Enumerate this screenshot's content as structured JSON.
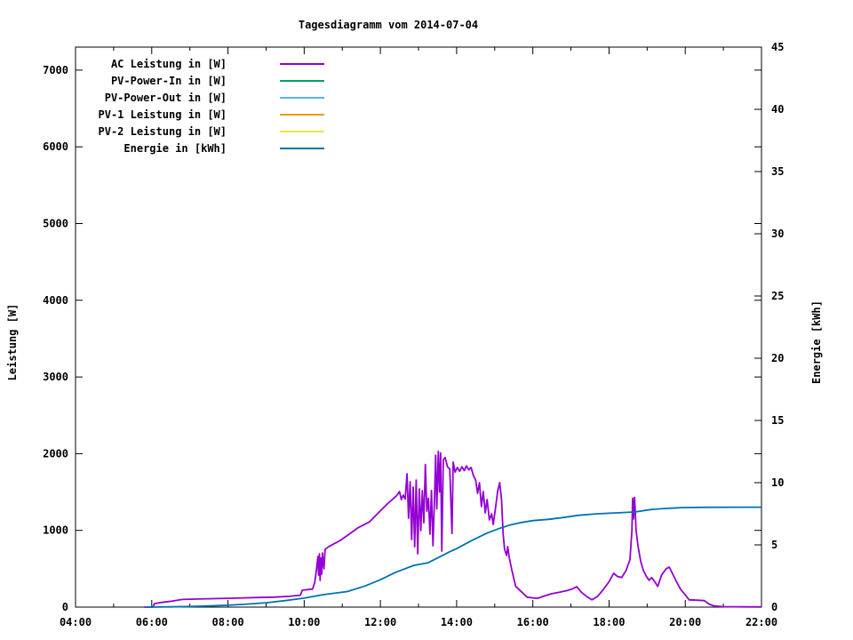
{
  "chart_data": {
    "type": "line",
    "title": "Tagesdiagramm vom 2014-07-04",
    "x_axis": {
      "range_hours": [
        4,
        22
      ],
      "major_tick_hours": [
        4,
        6,
        8,
        10,
        12,
        14,
        16,
        18,
        20,
        22
      ],
      "major_tick_labels": [
        "04:00",
        "06:00",
        "08:00",
        "10:00",
        "12:00",
        "14:00",
        "16:00",
        "18:00",
        "20:00",
        "22:00"
      ],
      "minor_tick_hours": [
        5,
        7,
        9,
        11,
        13,
        15,
        17,
        19,
        21
      ]
    },
    "y_axis_left": {
      "label": "Leistung [W]",
      "tick_values": [
        0,
        1000,
        2000,
        3000,
        4000,
        5000,
        6000,
        7000
      ],
      "range": [
        0,
        7300
      ]
    },
    "y_axis_right": {
      "label": "Energie [kWh]",
      "tick_values": [
        0,
        5,
        10,
        15,
        20,
        25,
        30,
        35,
        40,
        45
      ],
      "range": [
        0,
        45
      ]
    },
    "legend_position": "top-left",
    "grid": false,
    "series": [
      {
        "name": "AC Leistung in [W]",
        "color": "#9400d3",
        "axis": "left",
        "points": [
          [
            5.8,
            0
          ],
          [
            6.03,
            0
          ],
          [
            6.07,
            45
          ],
          [
            6.25,
            60
          ],
          [
            6.55,
            80
          ],
          [
            6.8,
            100
          ],
          [
            7.2,
            105
          ],
          [
            7.6,
            110
          ],
          [
            8.0,
            115
          ],
          [
            8.4,
            120
          ],
          [
            8.8,
            125
          ],
          [
            9.2,
            130
          ],
          [
            9.6,
            140
          ],
          [
            9.9,
            155
          ],
          [
            9.95,
            220
          ],
          [
            10.22,
            235
          ],
          [
            10.28,
            324
          ],
          [
            10.33,
            520
          ],
          [
            10.36,
            660
          ],
          [
            10.38,
            417
          ],
          [
            10.4,
            695
          ],
          [
            10.42,
            348
          ],
          [
            10.44,
            640
          ],
          [
            10.46,
            430
          ],
          [
            10.48,
            707
          ],
          [
            10.52,
            500
          ],
          [
            10.55,
            753
          ],
          [
            10.65,
            790
          ],
          [
            10.8,
            830
          ],
          [
            10.95,
            870
          ],
          [
            11.15,
            940
          ],
          [
            11.4,
            1030
          ],
          [
            11.72,
            1113
          ],
          [
            11.95,
            1230
          ],
          [
            12.18,
            1344
          ],
          [
            12.42,
            1449
          ],
          [
            12.5,
            1506
          ],
          [
            12.55,
            1402
          ],
          [
            12.6,
            1460
          ],
          [
            12.65,
            1410
          ],
          [
            12.7,
            1738
          ],
          [
            12.74,
            1159
          ],
          [
            12.78,
            1634
          ],
          [
            12.82,
            881
          ],
          [
            12.86,
            1564
          ],
          [
            12.9,
            788
          ],
          [
            12.94,
            1657
          ],
          [
            12.98,
            695
          ],
          [
            13.02,
            1541
          ],
          [
            13.06,
            997
          ],
          [
            13.1,
            1518
          ],
          [
            13.14,
            1100
          ],
          [
            13.18,
            1860
          ],
          [
            13.22,
            1250
          ],
          [
            13.26,
            1420
          ],
          [
            13.3,
            950
          ],
          [
            13.34,
            1520
          ],
          [
            13.38,
            800
          ],
          [
            13.42,
            1400
          ],
          [
            13.45,
            1980
          ],
          [
            13.48,
            1280
          ],
          [
            13.52,
            2030
          ],
          [
            13.55,
            1500
          ],
          [
            13.58,
            2010
          ],
          [
            13.61,
            730
          ],
          [
            13.65,
            1920
          ],
          [
            13.7,
            1950
          ],
          [
            13.76,
            1830
          ],
          [
            13.82,
            1800
          ],
          [
            13.88,
            960
          ],
          [
            13.91,
            1890
          ],
          [
            13.96,
            1760
          ],
          [
            14.02,
            1820
          ],
          [
            14.08,
            1770
          ],
          [
            14.14,
            1830
          ],
          [
            14.2,
            1780
          ],
          [
            14.26,
            1840
          ],
          [
            14.32,
            1790
          ],
          [
            14.38,
            1820
          ],
          [
            14.44,
            1715
          ],
          [
            14.5,
            1657
          ],
          [
            14.55,
            1483
          ],
          [
            14.6,
            1622
          ],
          [
            14.65,
            1310
          ],
          [
            14.7,
            1506
          ],
          [
            14.75,
            1228
          ],
          [
            14.8,
            1402
          ],
          [
            14.86,
            1136
          ],
          [
            14.92,
            1217
          ],
          [
            14.96,
            1078
          ],
          [
            15.02,
            1286
          ],
          [
            15.08,
            1518
          ],
          [
            15.13,
            1622
          ],
          [
            15.18,
            1391
          ],
          [
            15.22,
            962
          ],
          [
            15.26,
            753
          ],
          [
            15.31,
            672
          ],
          [
            15.34,
            788
          ],
          [
            15.38,
            649
          ],
          [
            15.45,
            480
          ],
          [
            15.55,
            270
          ],
          [
            15.7,
            200
          ],
          [
            15.85,
            130
          ],
          [
            16.0,
            120
          ],
          [
            16.12,
            115
          ],
          [
            16.3,
            145
          ],
          [
            16.5,
            175
          ],
          [
            16.7,
            195
          ],
          [
            16.9,
            215
          ],
          [
            17.05,
            240
          ],
          [
            17.15,
            267
          ],
          [
            17.28,
            190
          ],
          [
            17.42,
            135
          ],
          [
            17.55,
            95
          ],
          [
            17.7,
            140
          ],
          [
            17.85,
            230
          ],
          [
            18.0,
            330
          ],
          [
            18.12,
            440
          ],
          [
            18.22,
            400
          ],
          [
            18.33,
            385
          ],
          [
            18.45,
            480
          ],
          [
            18.55,
            620
          ],
          [
            18.6,
            1000
          ],
          [
            18.62,
            1420
          ],
          [
            18.64,
            1150
          ],
          [
            18.67,
            1430
          ],
          [
            18.71,
            1000
          ],
          [
            18.76,
            800
          ],
          [
            18.83,
            600
          ],
          [
            18.9,
            480
          ],
          [
            18.98,
            400
          ],
          [
            19.05,
            350
          ],
          [
            19.12,
            385
          ],
          [
            19.2,
            330
          ],
          [
            19.28,
            270
          ],
          [
            19.38,
            420
          ],
          [
            19.5,
            500
          ],
          [
            19.58,
            521
          ],
          [
            19.67,
            430
          ],
          [
            19.77,
            330
          ],
          [
            19.88,
            230
          ],
          [
            20.0,
            160
          ],
          [
            20.1,
            95
          ],
          [
            20.3,
            90
          ],
          [
            20.5,
            85
          ],
          [
            20.62,
            40
          ],
          [
            20.75,
            15
          ],
          [
            21.0,
            6
          ],
          [
            21.5,
            3
          ],
          [
            22.0,
            2
          ]
        ]
      },
      {
        "name": "PV-Power-In in [W]",
        "color": "#009e73",
        "axis": "left",
        "points": []
      },
      {
        "name": "PV-Power-Out in [W]",
        "color": "#56b4e9",
        "axis": "left",
        "points": []
      },
      {
        "name": "PV-1 Leistung in [W]",
        "color": "#e69f00",
        "axis": "left",
        "points": []
      },
      {
        "name": "PV-2 Leistung in [W]",
        "color": "#f0e442",
        "axis": "left",
        "points": []
      },
      {
        "name": "Energie in [kWh]",
        "color": "#0072b2",
        "axis": "right",
        "points": [
          [
            5.85,
            0
          ],
          [
            6.5,
            0.02
          ],
          [
            7.0,
            0.05
          ],
          [
            7.5,
            0.09
          ],
          [
            8.0,
            0.15
          ],
          [
            8.5,
            0.24
          ],
          [
            9.0,
            0.35
          ],
          [
            9.5,
            0.52
          ],
          [
            10.0,
            0.72
          ],
          [
            10.5,
            1.0
          ],
          [
            11.13,
            1.25
          ],
          [
            11.6,
            1.7
          ],
          [
            12.0,
            2.2
          ],
          [
            12.4,
            2.8
          ],
          [
            12.88,
            3.36
          ],
          [
            13.24,
            3.55
          ],
          [
            13.6,
            4.1
          ],
          [
            13.82,
            4.45
          ],
          [
            14.0,
            4.7
          ],
          [
            14.4,
            5.35
          ],
          [
            14.8,
            5.95
          ],
          [
            15.1,
            6.3
          ],
          [
            15.4,
            6.6
          ],
          [
            15.7,
            6.8
          ],
          [
            16.0,
            6.95
          ],
          [
            16.4,
            7.05
          ],
          [
            16.8,
            7.2
          ],
          [
            17.2,
            7.38
          ],
          [
            17.7,
            7.5
          ],
          [
            18.2,
            7.57
          ],
          [
            18.7,
            7.65
          ],
          [
            19.0,
            7.8
          ],
          [
            19.15,
            7.86
          ],
          [
            19.5,
            7.93
          ],
          [
            19.94,
            8.0
          ],
          [
            20.6,
            8.02
          ],
          [
            21.5,
            8.03
          ],
          [
            22.0,
            8.03
          ]
        ]
      }
    ]
  }
}
